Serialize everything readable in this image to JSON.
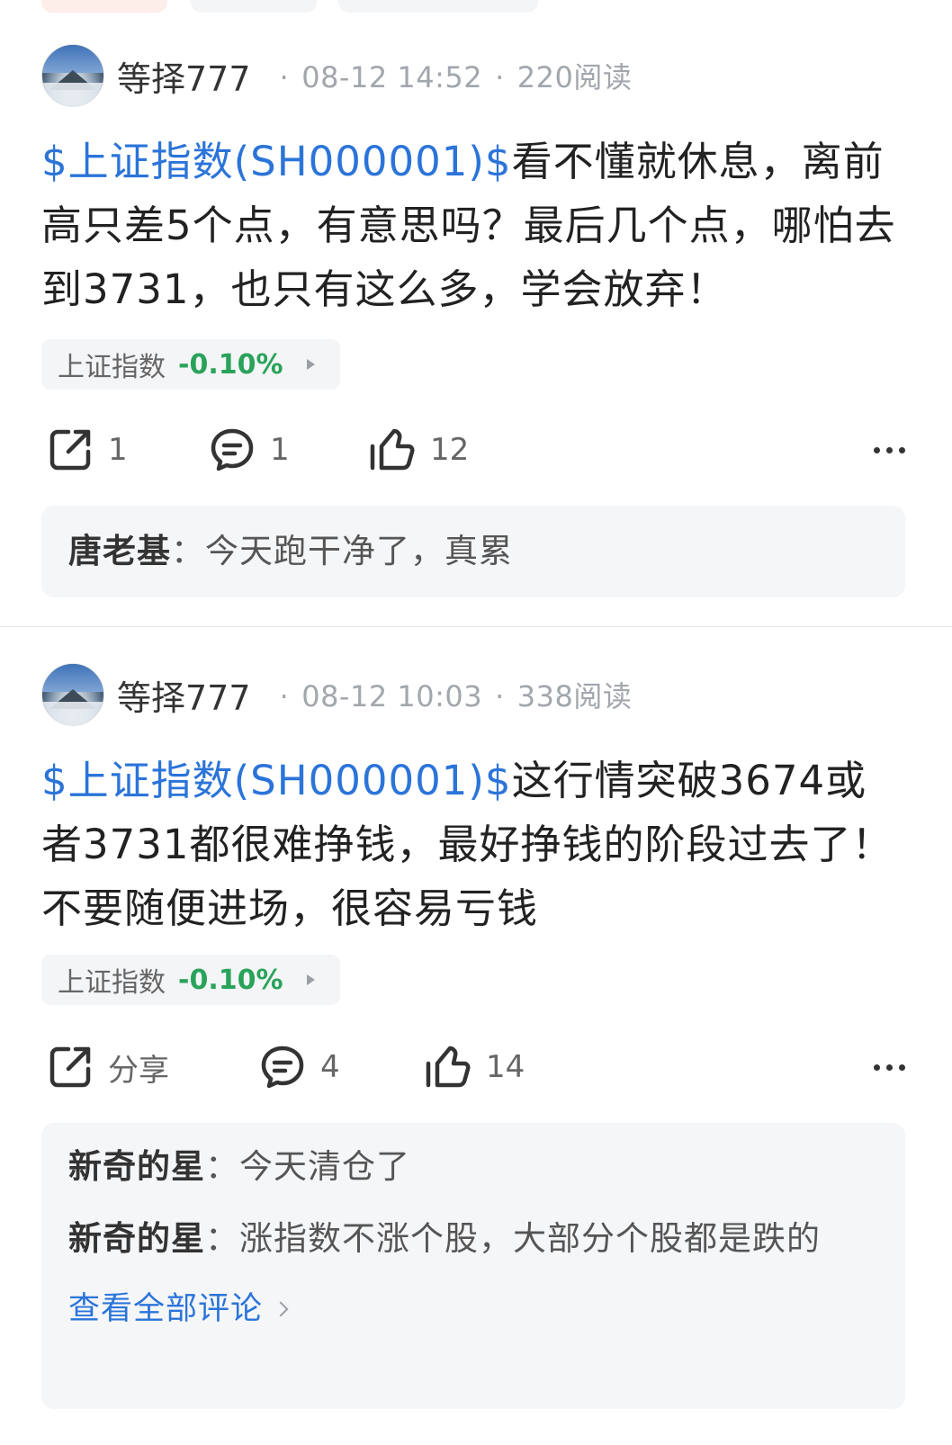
{
  "posts": [
    {
      "username": "等择777",
      "datetime": "08-12 14:52",
      "reads": "220阅读",
      "stock_link": "$上证指数(SH000001)$",
      "text": "看不懂就休息，离前高只差5个点，有意思吗？最后几个点，哪怕去到3731，也只有这么多，学会放弃！",
      "tag": {
        "name": "上证指数",
        "change": "-0.10%"
      },
      "share": "1",
      "comments_count": "1",
      "likes": "12",
      "comments": [
        {
          "author": "唐老基",
          "text": "今天跑干净了，真累"
        }
      ]
    },
    {
      "username": "等择777",
      "datetime": "08-12 10:03",
      "reads": "338阅读",
      "stock_link": "$上证指数(SH000001)$",
      "text": "这行情突破3674或者3731都很难挣钱，最好挣钱的阶段过去了！不要随便进场，很容易亏钱",
      "tag": {
        "name": "上证指数",
        "change": "-0.10%"
      },
      "share": "分享",
      "comments_count": "4",
      "likes": "14",
      "comments": [
        {
          "author": "新奇的星",
          "text": "今天清仓了"
        },
        {
          "author": "新奇的星",
          "text": "涨指数不涨个股，大部分个股都是跌的"
        }
      ],
      "view_all": "查看全部评论"
    }
  ],
  "separator": "·",
  "colon": "：",
  "colors": {
    "link": "#2b74d9",
    "down": "#2aa35a",
    "meta": "#a2a6ad",
    "panel": "#f5f6f8"
  },
  "icons": [
    "share-icon",
    "comment-icon",
    "like-icon",
    "more-icon",
    "chevron-right-icon"
  ]
}
